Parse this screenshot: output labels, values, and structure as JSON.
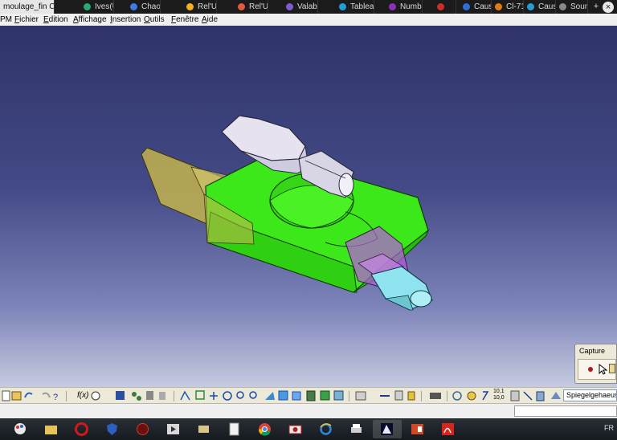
{
  "browser_tabs": {
    "items": [
      {
        "label": "moulage_fin CATPart",
        "active": true
      },
      {
        "label": "Ives(U",
        "color": "#2aa876"
      },
      {
        "label": "Chaoui",
        "color": "#3c7be0"
      },
      {
        "label": "Rel'U",
        "color": "#f2b01e"
      },
      {
        "label": "Rel'U",
        "color": "#e25b3b"
      },
      {
        "label": "Valable",
        "color": "#7e5cd0"
      },
      {
        "label": "Tableau",
        "color": "#1f9fd6"
      },
      {
        "label": "Numba",
        "color": "#8f2fb5"
      },
      {
        "label": "",
        "color": "#cc2d2d"
      },
      {
        "label": "Cause",
        "color": "#2b6fd1"
      },
      {
        "label": "Cl-71",
        "color": "#e07b1c"
      },
      {
        "label": "Cause",
        "color": "#2b9ad1"
      },
      {
        "label": "Sound",
        "color": "#888888"
      }
    ],
    "add_label": "+",
    "close_label": "×"
  },
  "menubar": {
    "app_prefix": "PM",
    "items": [
      {
        "label": "Fichier",
        "u": "F",
        "rest": "ichier"
      },
      {
        "label": "Edition",
        "u": "E",
        "rest": "dition"
      },
      {
        "label": "Affichage",
        "u": "A",
        "rest": "ffichage"
      },
      {
        "label": "Insertion",
        "u": "I",
        "rest": "nsertion"
      },
      {
        "label": "Outils",
        "u": "O",
        "rest": "utils"
      },
      {
        "label": "Fenêtre",
        "u": "F",
        "rest": "enêtre"
      },
      {
        "label": "Aide",
        "u": "A",
        "rest": "ide"
      }
    ]
  },
  "capture_panel": {
    "title": "Capture"
  },
  "toolbar": {
    "combo_value": "Spiegelgehaeuse_Ha",
    "formula_label": "f(x)",
    "units_top": "10,1",
    "units_bottom": "10,0"
  },
  "taskbar": {
    "language": "FR",
    "apps": [
      "paint-app",
      "file-explorer",
      "opera",
      "antivirus",
      "game-app",
      "media-player",
      "ebook-reader",
      "notepad",
      "chrome",
      "video-recorder",
      "internet-explorer",
      "printer",
      "catia",
      "powerpoint",
      "acrobat"
    ],
    "active_app": "catia"
  },
  "colors": {
    "viewport_top": "#2f3368",
    "viewport_bottom": "#c6cbe0",
    "part_green": "#3de81a",
    "part_yellow": "#c8b74c",
    "part_white": "#e6e3ef",
    "part_magenta": "#b85ae0",
    "part_cyan": "#8fe3ee"
  }
}
